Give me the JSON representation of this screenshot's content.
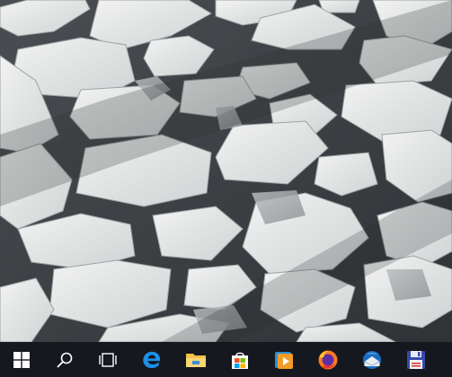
{
  "desktop": {
    "wallpaper": "ice-floes-on-dark-water",
    "colors": {
      "water": "#3b3f43",
      "ice": "#e8eae9",
      "ice_shadow": "#a9adb0"
    }
  },
  "taskbar": {
    "background": "#12161c",
    "indicator_color": "#7eb4ea",
    "system_buttons": [
      {
        "name": "start-button",
        "icon": "windows-logo-icon"
      },
      {
        "name": "search-button",
        "icon": "search-icon"
      },
      {
        "name": "task-view-button",
        "icon": "task-view-icon"
      }
    ],
    "pinned_apps": [
      {
        "name": "edge",
        "icon": "edge-icon",
        "running": false
      },
      {
        "name": "file-explorer",
        "icon": "file-explorer-icon",
        "running": false
      },
      {
        "name": "microsoft-store",
        "icon": "store-icon",
        "running": false
      },
      {
        "name": "media-player",
        "icon": "media-player-icon",
        "running": false
      },
      {
        "name": "firefox",
        "icon": "firefox-icon",
        "running": false
      },
      {
        "name": "thunderbird",
        "icon": "thunderbird-icon",
        "running": false
      },
      {
        "name": "save-app",
        "icon": "floppy-disk-icon",
        "running": false
      }
    ]
  }
}
